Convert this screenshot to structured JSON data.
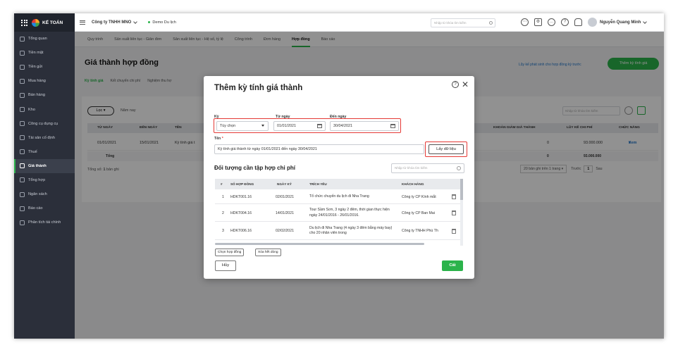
{
  "app": {
    "name": "KẾ TOÁN"
  },
  "sidebar": {
    "items": [
      {
        "label": "Tổng quan",
        "icon": "dashboard-icon"
      },
      {
        "label": "Tiền mặt",
        "icon": "cash-icon"
      },
      {
        "label": "Tiền gửi",
        "icon": "bank-icon"
      },
      {
        "label": "Mua hàng",
        "icon": "shopping-bag-icon"
      },
      {
        "label": "Bán hàng",
        "icon": "cart-icon"
      },
      {
        "label": "Kho",
        "icon": "warehouse-icon"
      },
      {
        "label": "Công cụ dụng cụ",
        "icon": "tools-icon"
      },
      {
        "label": "Tài sản cố định",
        "icon": "asset-icon"
      },
      {
        "label": "Thuế",
        "icon": "tax-icon"
      },
      {
        "label": "Giá thành",
        "icon": "cost-icon",
        "active": true
      },
      {
        "label": "Tổng hợp",
        "icon": "summary-icon"
      },
      {
        "label": "Ngân sách",
        "icon": "budget-icon"
      },
      {
        "label": "Báo cáo",
        "icon": "report-icon"
      },
      {
        "label": "Phân tích tài chính",
        "icon": "analytics-icon"
      }
    ]
  },
  "topbar": {
    "company": "Công ty TNHH MNO",
    "demo": "Demo Du lịch",
    "search_placeholder": "Nhập từ khóa tìm kiếm",
    "user": "Nguyễn Quang Minh"
  },
  "tabs": [
    {
      "label": "Quy trình"
    },
    {
      "label": "Sản xuất liên tục - Giản đơn"
    },
    {
      "label": "Sản xuất liên tục - Hệ số, tỷ lệ"
    },
    {
      "label": "Công trình"
    },
    {
      "label": "Đơn hàng"
    },
    {
      "label": "Hợp đồng",
      "active": true
    },
    {
      "label": "Báo cáo"
    }
  ],
  "page": {
    "title": "Giá thành hợp đồng",
    "link_prev": "Lũy kế phát sinh cho hợp đồng kỳ trước",
    "add_button": "Thêm kỳ tính giá",
    "subtabs": [
      "Kỳ tính giá",
      "Kết chuyển chi phí",
      "Nghiệm thu hợ"
    ],
    "filter_label": "Lọc",
    "period": "Năm nay",
    "search_placeholder": "Nhập từ khóa tìm kiếm",
    "columns": [
      "TỪ NGÀY",
      "ĐẾN NGÀY",
      "TÊN",
      "KHOẢN GIẢM GIÁ THÀNH",
      "LŨY KẾ CHI PHÍ",
      "CHỨC NĂNG"
    ],
    "row": {
      "from": "01/01/2021",
      "to": "15/01/2021",
      "name": "Kỳ tính giá t",
      "discount": "0",
      "cumulative": "93.000.000",
      "action": "Xem"
    },
    "total": {
      "label": "Tổng",
      "discount": "0",
      "cumulative": "93.000.000"
    },
    "footer_count": "Tổng số: 1 bản ghi",
    "footer_count_prefix": "Tổng số: ",
    "footer_count_num": "1",
    "footer_count_suffix": " bản ghi",
    "page_size": "20 bản ghi trên 1 trang",
    "prev": "Trước",
    "page_num": "1",
    "next": "Sau"
  },
  "modal": {
    "title": "Thêm kỳ tính giá thành",
    "period_label": "Kỳ",
    "period_value": "Tùy chọn",
    "from_label": "Từ ngày",
    "from_value": "01/01/2021",
    "to_label": "Đến ngày",
    "to_value": "30/04/2021",
    "name_label": "Tên",
    "name_value": "Kỳ tính giá thành từ ngày 01/01/2021 đến ngày 30/04/2021",
    "get_data": "Lấy dữ liệu",
    "section_title": "Đối tượng cần tập hợp chi phí",
    "search_placeholder": "Nhập từ khóa tìm kiếm",
    "columns": [
      "#",
      "SỐ HỢP ĐỒNG",
      "NGÀY KÝ",
      "TRÍCH YẾU",
      "KHÁCH HÀNG"
    ],
    "rows": [
      {
        "n": "1",
        "contract": "HDKT001.16",
        "date": "02/01/2021",
        "summary": "Tổ chức chuyến du lịch đi Nha Trang",
        "customer": "Công ty CP Kính mắt"
      },
      {
        "n": "2",
        "contract": "HDKT004.16",
        "date": "14/01/2021",
        "summary": "Tour Sầm Sơn, 3 ngày 2 đêm, thời gian thực hiện ngày 24/01/2016 - 26/01/2016.",
        "customer": "Công ty CP Ban Mai"
      },
      {
        "n": "3",
        "contract": "HDKT006.16",
        "date": "02/02/2021",
        "summary": "Du lịch đi Nha Trang (4 ngày 3 đêm bằng máy bay) cho 20 nhân viên trong",
        "customer": "Công ty TNHH Phú Th"
      }
    ],
    "choose_btn": "Chọn hợp đồng",
    "clear_btn": "Xóa hết dòng",
    "cancel": "Hủy",
    "save": "Cất"
  }
}
